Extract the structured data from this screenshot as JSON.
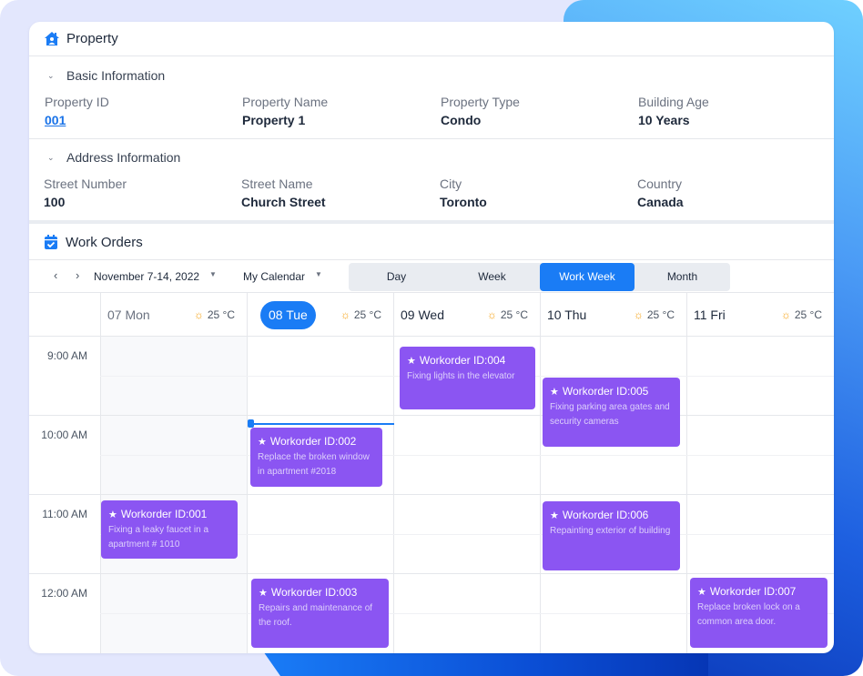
{
  "property_panel": {
    "title": "Property",
    "icon": "home-icon",
    "basic_info": {
      "title": "Basic Information",
      "fields": [
        {
          "label": "Property ID",
          "value": "001"
        },
        {
          "label": "Property Name",
          "value": "Property 1"
        },
        {
          "label": "Property Type",
          "value": "Condo"
        },
        {
          "label": "Building Age",
          "value": "10 Years"
        }
      ]
    },
    "address_info": {
      "title": "Address Information",
      "fields": [
        {
          "label": "Street Number",
          "value": "100"
        },
        {
          "label": "Street Name",
          "value": "Church Street"
        },
        {
          "label": "City",
          "value": "Toronto"
        },
        {
          "label": "Country",
          "value": "Canada"
        }
      ]
    }
  },
  "work_orders": {
    "title": "Work Orders",
    "icon": "calendar-check-icon",
    "toolbar": {
      "prev": "‹",
      "next": "›",
      "date_range": "November 7-14, 2022",
      "calendar": "My Calendar",
      "views": [
        "Day",
        "Week",
        "Work Week",
        "Month"
      ],
      "active_view": "Work Week"
    },
    "days": [
      {
        "label": "07 Mon",
        "weather": "25 °C",
        "state": "past"
      },
      {
        "label": "08 Tue",
        "weather": "25 °C",
        "state": "today"
      },
      {
        "label": "09 Wed",
        "weather": "25 °C",
        "state": "future"
      },
      {
        "label": "10 Thu",
        "weather": "25 °C",
        "state": "future"
      },
      {
        "label": "11 Fri",
        "weather": "25 °C",
        "state": "future"
      }
    ],
    "times": [
      "9:00 AM",
      "10:00 AM",
      "11:00 AM",
      "12:00 AM"
    ],
    "events": [
      {
        "title": "Workorder ID:001",
        "desc": "Fixing a leaky faucet in a  apartment # 1010",
        "day": "07 Mon",
        "start": "11:00 AM"
      },
      {
        "title": "Workorder ID:002",
        "desc": "Replace the broken window in apartment #2018",
        "day": "08 Tue",
        "start": "10:00 AM"
      },
      {
        "title": "Workorder ID:003",
        "desc": "Repairs and maintenance of the roof.",
        "day": "08 Tue",
        "start": "12:00 AM"
      },
      {
        "title": "Workorder ID:004",
        "desc": "Fixing lights in the elevator",
        "day": "09 Wed",
        "start": "9:00 AM"
      },
      {
        "title": "Workorder ID:005",
        "desc": "Fixing parking area gates and security cameras",
        "day": "10 Thu",
        "start": "9:30 AM"
      },
      {
        "title": "Workorder ID:006",
        "desc": "Repainting exterior of building",
        "day": "10 Thu",
        "start": "11:00 AM"
      },
      {
        "title": "Workorder ID:007",
        "desc": "Replace broken lock on a common area door.",
        "day": "11 Fri",
        "start": "12:00 AM"
      }
    ]
  },
  "colors": {
    "accent": "#1a7cf5",
    "event": "#8b55f2",
    "background": "#e3e7fd"
  }
}
